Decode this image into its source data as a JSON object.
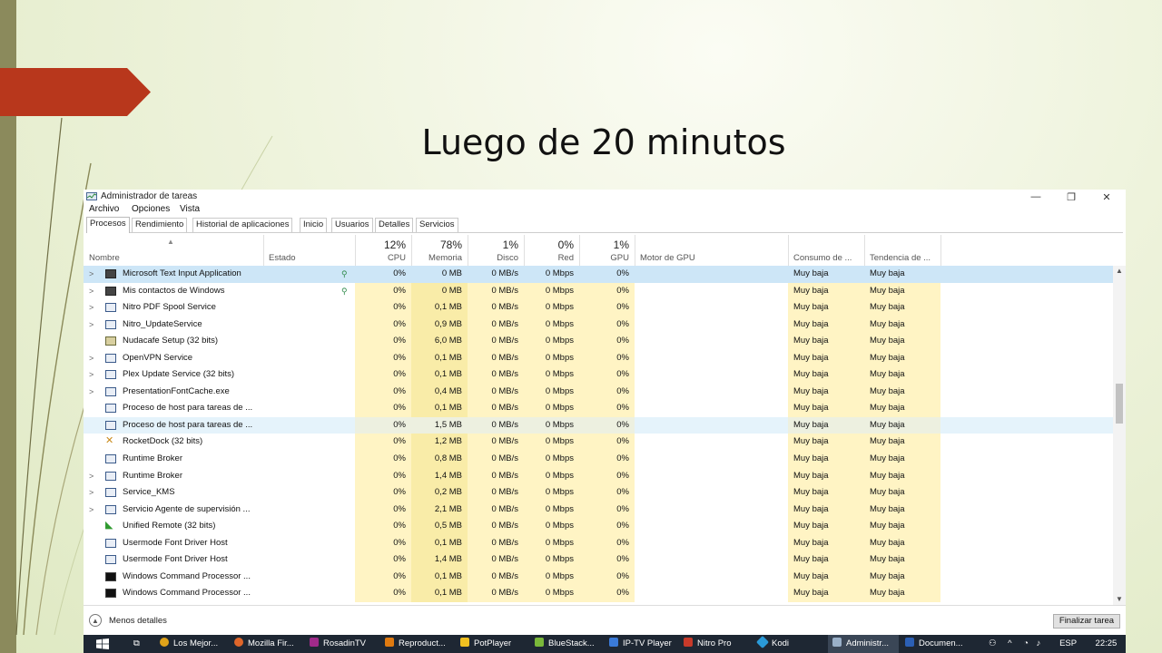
{
  "slide": {
    "title": "Luego de 20 minutos"
  },
  "window": {
    "title": "Administrador de tareas",
    "controls": {
      "minimize": "—",
      "maximize": "❐",
      "close": "✕"
    },
    "menu": [
      "Archivo",
      "Opciones",
      "Vista"
    ],
    "tabs": [
      "Procesos",
      "Rendimiento",
      "Historial de aplicaciones",
      "Inicio",
      "Usuarios",
      "Detalles",
      "Servicios"
    ],
    "columns": {
      "name": "Nombre",
      "status": "Estado",
      "cpu": {
        "pct": "12%",
        "label": "CPU"
      },
      "memory": {
        "pct": "78%",
        "label": "Memoria"
      },
      "disk": {
        "pct": "1%",
        "label": "Disco"
      },
      "network": {
        "pct": "0%",
        "label": "Red"
      },
      "gpu": {
        "pct": "1%",
        "label": "GPU"
      },
      "gpu_engine": "Motor de GPU",
      "power": "Consumo de ...",
      "power_trend": "Tendencia de ..."
    },
    "rows": [
      {
        "name": "Microsoft Text Input Application",
        "cpu": "0%",
        "mem": "0 MB",
        "disk": "0 MB/s",
        "net": "0 Mbps",
        "gpu": "0%",
        "power": "Muy baja",
        "trend": "Muy baja"
      },
      {
        "name": "Mis contactos de Windows",
        "cpu": "0%",
        "mem": "0 MB",
        "disk": "0 MB/s",
        "net": "0 Mbps",
        "gpu": "0%",
        "power": "Muy baja",
        "trend": "Muy baja"
      },
      {
        "name": "Nitro PDF Spool Service",
        "cpu": "0%",
        "mem": "0,1 MB",
        "disk": "0 MB/s",
        "net": "0 Mbps",
        "gpu": "0%",
        "power": "Muy baja",
        "trend": "Muy baja"
      },
      {
        "name": "Nitro_UpdateService",
        "cpu": "0%",
        "mem": "0,9 MB",
        "disk": "0 MB/s",
        "net": "0 Mbps",
        "gpu": "0%",
        "power": "Muy baja",
        "trend": "Muy baja"
      },
      {
        "name": "Nudacafe Setup (32 bits)",
        "cpu": "0%",
        "mem": "6,0 MB",
        "disk": "0 MB/s",
        "net": "0 Mbps",
        "gpu": "0%",
        "power": "Muy baja",
        "trend": "Muy baja"
      },
      {
        "name": "OpenVPN Service",
        "cpu": "0%",
        "mem": "0,1 MB",
        "disk": "0 MB/s",
        "net": "0 Mbps",
        "gpu": "0%",
        "power": "Muy baja",
        "trend": "Muy baja"
      },
      {
        "name": "Plex Update Service (32 bits)",
        "cpu": "0%",
        "mem": "0,1 MB",
        "disk": "0 MB/s",
        "net": "0 Mbps",
        "gpu": "0%",
        "power": "Muy baja",
        "trend": "Muy baja"
      },
      {
        "name": "PresentationFontCache.exe",
        "cpu": "0%",
        "mem": "0,4 MB",
        "disk": "0 MB/s",
        "net": "0 Mbps",
        "gpu": "0%",
        "power": "Muy baja",
        "trend": "Muy baja"
      },
      {
        "name": "Proceso de host para tareas de ...",
        "cpu": "0%",
        "mem": "0,1 MB",
        "disk": "0 MB/s",
        "net": "0 Mbps",
        "gpu": "0%",
        "power": "Muy baja",
        "trend": "Muy baja"
      },
      {
        "name": "Proceso de host para tareas de ...",
        "cpu": "0%",
        "mem": "1,5 MB",
        "disk": "0 MB/s",
        "net": "0 Mbps",
        "gpu": "0%",
        "power": "Muy baja",
        "trend": "Muy baja"
      },
      {
        "name": "RocketDock (32 bits)",
        "cpu": "0%",
        "mem": "1,2 MB",
        "disk": "0 MB/s",
        "net": "0 Mbps",
        "gpu": "0%",
        "power": "Muy baja",
        "trend": "Muy baja"
      },
      {
        "name": "Runtime Broker",
        "cpu": "0%",
        "mem": "0,8 MB",
        "disk": "0 MB/s",
        "net": "0 Mbps",
        "gpu": "0%",
        "power": "Muy baja",
        "trend": "Muy baja"
      },
      {
        "name": "Runtime Broker",
        "cpu": "0%",
        "mem": "1,4 MB",
        "disk": "0 MB/s",
        "net": "0 Mbps",
        "gpu": "0%",
        "power": "Muy baja",
        "trend": "Muy baja"
      },
      {
        "name": "Service_KMS",
        "cpu": "0%",
        "mem": "0,2 MB",
        "disk": "0 MB/s",
        "net": "0 Mbps",
        "gpu": "0%",
        "power": "Muy baja",
        "trend": "Muy baja"
      },
      {
        "name": "Servicio Agente de supervisión ...",
        "cpu": "0%",
        "mem": "2,1 MB",
        "disk": "0 MB/s",
        "net": "0 Mbps",
        "gpu": "0%",
        "power": "Muy baja",
        "trend": "Muy baja"
      },
      {
        "name": "Unified Remote (32 bits)",
        "cpu": "0%",
        "mem": "0,5 MB",
        "disk": "0 MB/s",
        "net": "0 Mbps",
        "gpu": "0%",
        "power": "Muy baja",
        "trend": "Muy baja"
      },
      {
        "name": "Usermode Font Driver Host",
        "cpu": "0%",
        "mem": "0,1 MB",
        "disk": "0 MB/s",
        "net": "0 Mbps",
        "gpu": "0%",
        "power": "Muy baja",
        "trend": "Muy baja"
      },
      {
        "name": "Usermode Font Driver Host",
        "cpu": "0%",
        "mem": "1,4 MB",
        "disk": "0 MB/s",
        "net": "0 Mbps",
        "gpu": "0%",
        "power": "Muy baja",
        "trend": "Muy baja"
      },
      {
        "name": "Windows Command Processor ...",
        "cpu": "0%",
        "mem": "0,1 MB",
        "disk": "0 MB/s",
        "net": "0 Mbps",
        "gpu": "0%",
        "power": "Muy baja",
        "trend": "Muy baja"
      },
      {
        "name": "Windows Command Processor ...",
        "cpu": "0%",
        "mem": "0,1 MB",
        "disk": "0 MB/s",
        "net": "0 Mbps",
        "gpu": "0%",
        "power": "Muy baja",
        "trend": "Muy baja"
      }
    ],
    "footer": {
      "fewer_details": "Menos detalles",
      "end_task": "Finalizar tarea"
    }
  },
  "taskbar": {
    "items": [
      "Los Mejor...",
      "Mozilla Fir...",
      "RosadinTV",
      "Reproduct...",
      "PotPlayer",
      "BlueStack...",
      "IP-TV Player",
      "Nitro Pro",
      "Kodi",
      "Administr...",
      "Documen..."
    ],
    "tray": {
      "language": "ESP",
      "time": "22:25"
    }
  }
}
